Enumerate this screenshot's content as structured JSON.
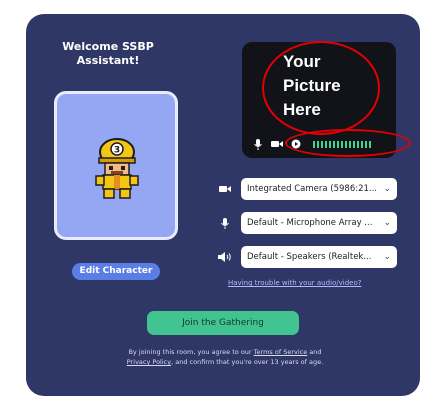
{
  "welcome": {
    "line1": "Welcome SSBP",
    "line2": "Assistant!"
  },
  "avatar": {
    "badge_text": "3"
  },
  "edit_button": "Edit Character",
  "video": {
    "overlay_lines": [
      "Your",
      "Picture",
      "Here"
    ]
  },
  "devices": {
    "camera": "Integrated Camera (5986:21...",
    "microphone": "Default - Microphone Array ...",
    "speaker": "Default - Speakers (Realtek..."
  },
  "trouble_link": "Having trouble with your audio/video?",
  "join_button": "Join the Gathering",
  "legal": {
    "pre": "By joining this room, you agree to our ",
    "terms": "Terms of Service",
    "and": " and",
    "privacy": "Privacy Policy",
    "post": ", and confirm that you're over 13 years of age."
  },
  "colors": {
    "card": "#2f3766",
    "avatar_bg": "#95a6f3",
    "edit_button": "#5a7ee6",
    "join_button": "#41c48f",
    "annotation": "#e40000"
  },
  "icons": [
    "microphone-icon",
    "camera-icon",
    "speaker-icon",
    "chevron-down-icon",
    "play-icon"
  ]
}
